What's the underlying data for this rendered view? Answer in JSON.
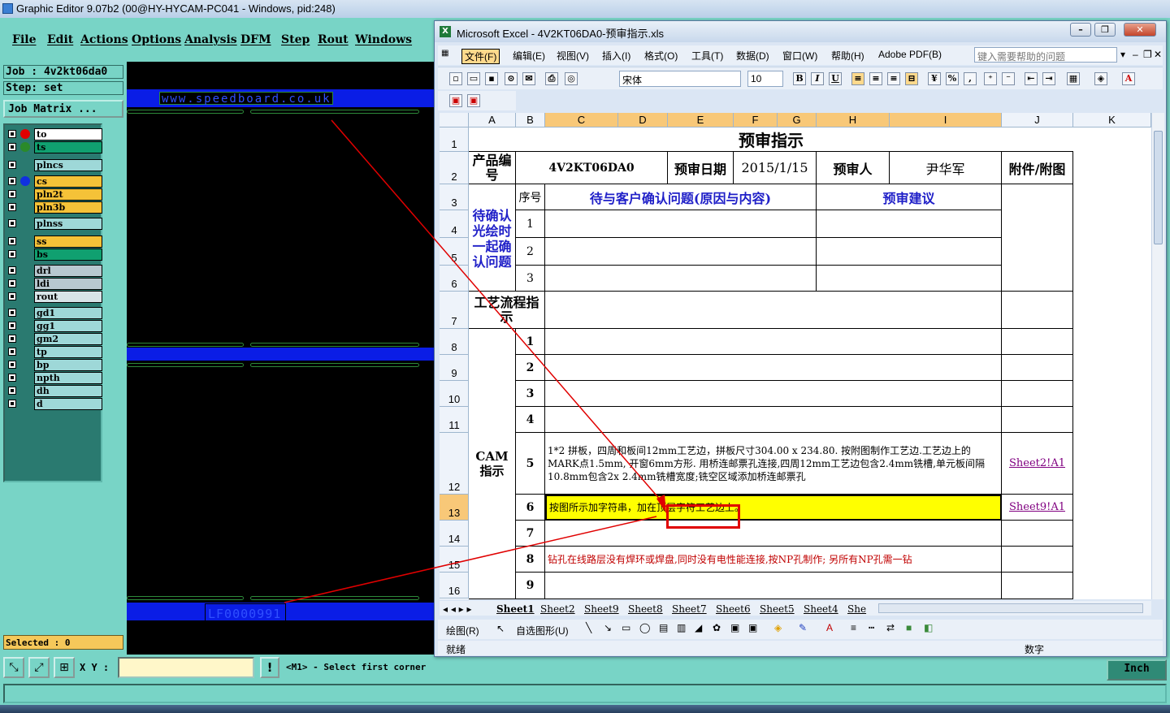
{
  "ge": {
    "title": "Graphic Editor 9.07b2 (00@HY-HYCAM-PC041 - Windows, pid:248)",
    "menu": [
      "File",
      "Edit",
      "Actions",
      "Options",
      "Analysis",
      "DFM",
      "Step",
      "Rout",
      "Windows"
    ],
    "job": "Job : 4v2kt06da0",
    "step": "Step: set",
    "job_matrix": "Job Matrix ...",
    "layers": [
      {
        "name": "to",
        "color": "#ffffff",
        "dot": "#e00000"
      },
      {
        "name": "ts",
        "color": "#10a070",
        "dot": "#2a8a2a"
      },
      {
        "name": "plncs",
        "color": "#9ed8d8",
        "dot": ""
      },
      {
        "name": "cs",
        "color": "#f5c238",
        "dot": "#1030e0"
      },
      {
        "name": "pln2t",
        "color": "#f5c238",
        "dot": ""
      },
      {
        "name": "pln3b",
        "color": "#f5c238",
        "dot": ""
      },
      {
        "name": "plnss",
        "color": "#9ed8d8",
        "dot": ""
      },
      {
        "name": "ss",
        "color": "#f5c238",
        "dot": ""
      },
      {
        "name": "bs",
        "color": "#10a070",
        "dot": ""
      },
      {
        "name": "drl",
        "color": "#b8c8d0",
        "dot": ""
      },
      {
        "name": "ldi",
        "color": "#b8c8d0",
        "dot": ""
      },
      {
        "name": "rout",
        "color": "#d8e4e8",
        "dot": ""
      },
      {
        "name": "gd1",
        "color": "#9ed8d8",
        "dot": ""
      },
      {
        "name": "gg1",
        "color": "#9ed8d8",
        "dot": ""
      },
      {
        "name": "gm2",
        "color": "#9ed8d8",
        "dot": ""
      },
      {
        "name": "tp",
        "color": "#9ed8d8",
        "dot": ""
      },
      {
        "name": "bp",
        "color": "#9ed8d8",
        "dot": ""
      },
      {
        "name": "npth",
        "color": "#9ed8d8",
        "dot": ""
      },
      {
        "name": "dh",
        "color": "#9ed8d8",
        "dot": ""
      },
      {
        "name": "d",
        "color": "#9ed8d8",
        "dot": ""
      }
    ],
    "selected": "Selected : 0",
    "canvas_url": "www.speedboard.co.uk",
    "canvas_lf": "LF0000991",
    "xy_label": "X Y :",
    "xy_value": "",
    "warn": "!",
    "prompt": "<M1> - Select first corner",
    "units": "Inch"
  },
  "xl": {
    "title": "Microsoft Excel - 4V2KT06DA0-预审指示.xls",
    "menu": [
      "文件(F)",
      "编辑(E)",
      "视图(V)",
      "插入(I)",
      "格式(O)",
      "工具(T)",
      "数据(D)",
      "窗口(W)",
      "帮助(H)",
      "Adobe PDF(B)"
    ],
    "help_placeholder": "键入需要帮助的问题",
    "font_name": "宋体",
    "font_size": "10",
    "columns": [
      "A",
      "B",
      "C",
      "D",
      "E",
      "F",
      "G",
      "H",
      "I",
      "J",
      "K"
    ],
    "rows": [
      "1",
      "2",
      "3",
      "4",
      "5",
      "6",
      "7",
      "8",
      "9",
      "10",
      "11",
      "12",
      "13",
      "14",
      "15",
      "16"
    ],
    "cells": {
      "title": "预审指示",
      "product_no_label": "产品编号",
      "product_no": "4V2KT06DA0",
      "review_date_label": "预审日期",
      "review_date": "2015/1/15",
      "reviewer_label": "预审人",
      "reviewer": "尹华军",
      "attachment_label": "附件/附图",
      "seq_label": "序号",
      "issue_header": "待与客户确认问题(原因与内容)",
      "suggest_header": "预审建议",
      "confirm_label": "待确认光绘时一起确认问题",
      "process_label": "工艺流程指示",
      "cam_label": "CAM指示",
      "seq": [
        "1",
        "2",
        "3",
        "1",
        "2",
        "3",
        "4",
        "5",
        "6",
        "7",
        "8",
        "9"
      ],
      "r12_text": "1*2 拼板，四周和板间12mm工艺边，拼板尺寸304.00 x 234.80. 按附图制作工艺边.工艺边上的MARK点1.5mm, 开窗6mm方形. 用桥连邮票孔连接,四周12mm工艺边包含2.4mm铣槽,单元板间隔10.8mm包含2x 2.4mm铣槽宽度;铣空区域添加桥连邮票孔",
      "r12_link": "Sheet2!A1",
      "r13_text": "按图所示加字符串，加在顶层字符工艺边上。",
      "r13_link": "Sheet9!A1",
      "r15_text": "钻孔在线路层没有焊环或焊盘,同时没有电性能连接,按NP孔制作; 另所有NP孔需一钻"
    },
    "sheets": [
      "Sheet1",
      "Sheet2",
      "Sheet9",
      "Sheet8",
      "Sheet7",
      "Sheet6",
      "Sheet5",
      "Sheet4",
      "She"
    ],
    "draw_label": "绘图(R)",
    "autoshape_label": "自选图形(U)",
    "status_ready": "就绪",
    "status_num": "数字"
  }
}
